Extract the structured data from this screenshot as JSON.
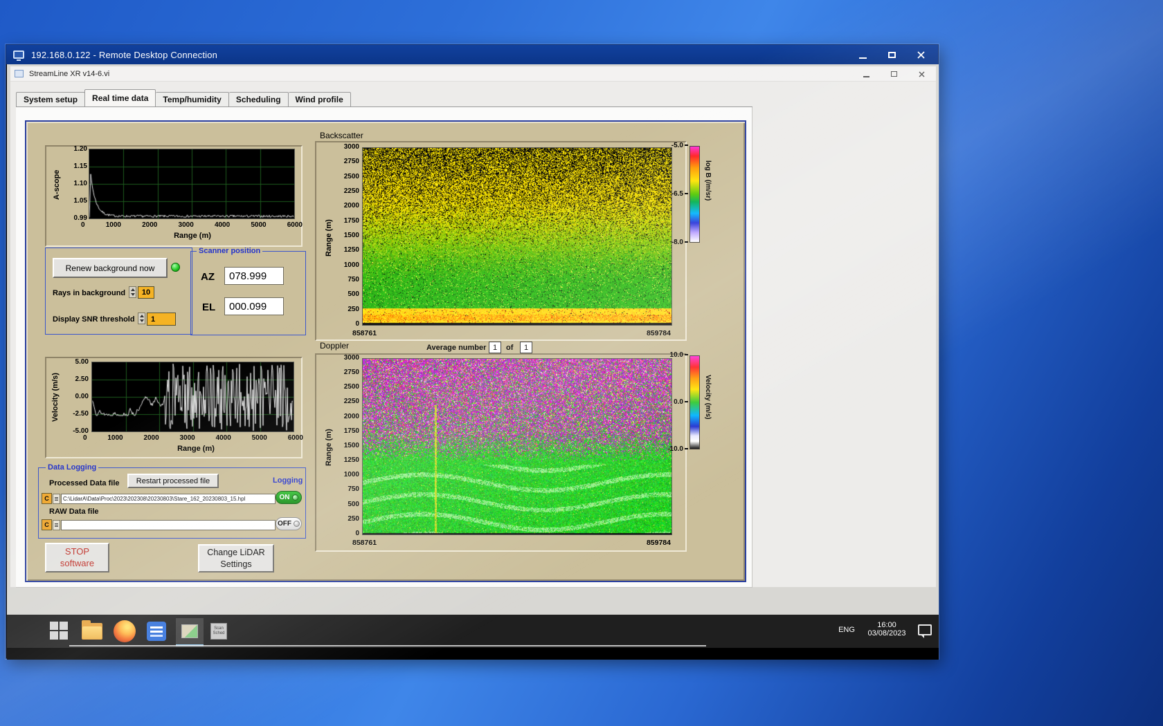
{
  "rdp_window": {
    "title": "192.168.0.122 - Remote Desktop Connection"
  },
  "app_window": {
    "title": "StreamLine XR v14-6.vi"
  },
  "tabs": [
    {
      "label": "System setup"
    },
    {
      "label": "Real time data"
    },
    {
      "label": "Temp/humidity"
    },
    {
      "label": "Scheduling"
    },
    {
      "label": "Wind profile"
    }
  ],
  "ascope": {
    "ylabel": "A-scope",
    "yticks": [
      "1.20",
      "1.15",
      "1.10",
      "1.05",
      "0.99"
    ],
    "xticks": [
      "0",
      "1000",
      "2000",
      "3000",
      "4000",
      "5000",
      "6000"
    ],
    "xlabel": "Range (m)"
  },
  "background_controls": {
    "renew_button": "Renew background now",
    "rays_label": "Rays in background",
    "rays_value": "10",
    "snr_label": "Display SNR threshold",
    "snr_value": "1"
  },
  "scanner": {
    "title": "Scanner position",
    "az_label": "AZ",
    "az_value": "078.999",
    "el_label": "EL",
    "el_value": "000.099"
  },
  "backscatter": {
    "title": "Backscatter",
    "ylabel": "Range (m)",
    "yticks": [
      "3000",
      "2750",
      "2500",
      "2250",
      "2000",
      "1750",
      "1500",
      "1250",
      "1000",
      "750",
      "500",
      "250",
      "0"
    ],
    "x_start": "858761",
    "x_end": "859784",
    "colorbar_ticks": [
      "-5.0",
      "-6.5",
      "-8.0"
    ],
    "colorbar_label": "log B (/m/sr)"
  },
  "doppler": {
    "title": "Doppler",
    "avg_label": "Average number",
    "avg_value": "1",
    "of_label": "of",
    "avg_total": "1",
    "ylabel": "Range (m)",
    "yticks": [
      "3000",
      "2750",
      "2500",
      "2250",
      "2000",
      "1750",
      "1500",
      "1250",
      "1000",
      "750",
      "500",
      "250",
      "0"
    ],
    "x_start": "858761",
    "x_end": "859784",
    "colorbar_ticks": [
      "10.0",
      "0.0",
      "-10.0"
    ],
    "colorbar_label": "Velocity (m/s)"
  },
  "velocity": {
    "ylabel": "Velocity (m/s)",
    "yticks": [
      "5.00",
      "2.50",
      "0.00",
      "-2.50",
      "-5.00"
    ],
    "xticks": [
      "0",
      "1000",
      "2000",
      "3000",
      "4000",
      "5000",
      "6000"
    ],
    "xlabel": "Range (m)"
  },
  "data_logging": {
    "title": "Data Logging",
    "processed_label": "Processed Data file",
    "restart_button": "Restart processed file",
    "logging_label": "Logging",
    "drive": "C",
    "processed_path": "C:\\LidarA\\Data\\Proc\\2023\\202308\\20230803\\Stare_162_20230803_15.hpl",
    "raw_label": "RAW Data file",
    "raw_path": "",
    "on_label": "ON",
    "off_label": "OFF"
  },
  "actions": {
    "stop_line1": "STOP",
    "stop_line2": "software",
    "change_line1": "Change LiDAR",
    "change_line2": "Settings"
  },
  "taskbar": {
    "lang": "ENG",
    "time": "16:00",
    "date": "03/08/2023",
    "scan_icon_line1": "Scan",
    "scan_icon_line2": "Sched"
  },
  "chart_data": [
    {
      "type": "line",
      "title": "A-scope",
      "ylabel": "A-scope",
      "xlabel": "Range (m)",
      "x_range": [
        0,
        6000
      ],
      "y_range": [
        0.99,
        1.2
      ],
      "yticks": [
        1.2,
        1.15,
        1.1,
        1.05,
        0.99
      ],
      "xticks": [
        0,
        1000,
        2000,
        3000,
        4000,
        5000,
        6000
      ],
      "series_note": "white trace peaks near 1.12 close to 0 m then decays to ~1.00 baseline with small noise"
    },
    {
      "type": "heatmap",
      "title": "Backscatter",
      "ylabel": "Range (m)",
      "y_range": [
        0,
        3000
      ],
      "x_ticks": [
        858761,
        859784
      ],
      "colorbar_label": "log B (/m/sr)",
      "colorbar_range": [
        -5.0,
        -8.0
      ],
      "colorbar_ticks": [
        -5.0,
        -6.5,
        -8.0
      ],
      "pattern": "yellow field with dense black dropout speckle above ~1750 m, greener band 250-1500 m, bright yellow-orange surface layer below 250 m with red streaks, black bottom edge"
    },
    {
      "type": "line",
      "title": "Velocity",
      "ylabel": "Velocity (m/s)",
      "xlabel": "Range (m)",
      "x_range": [
        0,
        6000
      ],
      "y_range": [
        -5,
        5
      ],
      "yticks": [
        5.0,
        2.5,
        0.0,
        -2.5,
        -5.0
      ],
      "xticks": [
        0,
        1000,
        2000,
        3000,
        4000,
        5000,
        6000
      ],
      "series_note": "coherent trace near -1 m/s out to ~2000 m, then saturated +/-5 m/s noise to 6000 m"
    },
    {
      "type": "heatmap",
      "title": "Doppler",
      "ylabel": "Range (m)",
      "y_range": [
        0,
        3000
      ],
      "x_ticks": [
        858761,
        859784
      ],
      "colorbar_label": "Velocity (m/s)",
      "colorbar_range": [
        10,
        -10
      ],
      "colorbar_ticks": [
        10.0,
        0.0,
        -10.0
      ],
      "pattern": "magenta noise above ~1600 m, green near-zero velocities below with wavy lighter bands and a narrow yellow-green vertical plume about a quarter of the way across"
    }
  ]
}
